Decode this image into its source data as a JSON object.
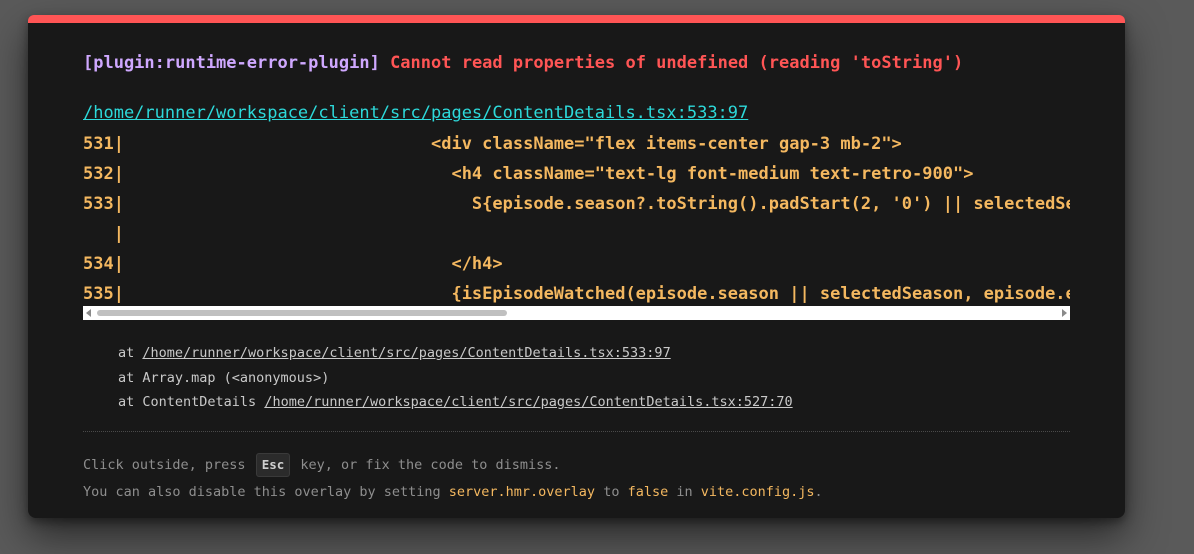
{
  "error": {
    "plugin": "[plugin:runtime-error-plugin]",
    "message": "Cannot read properties of undefined (reading 'toString')"
  },
  "file_link": "/home/runner/workspace/client/src/pages/ContentDetails.tsx:533:97",
  "code_lines": [
    "531|                              <div className=\"flex items-center gap-3 mb-2\">",
    "532|                                <h4 className=\"text-lg font-medium text-retro-900\">",
    "533|                                  S{episode.season?.toString().padStart(2, '0') || selectedSeason.toString().padStart(2, '0')}E{episode.episode",
    "   |",
    "534|                                </h4>",
    "535|                                {isEpisodeWatched(episode.season || selectedSeason, episode.episode) && ("
  ],
  "stack": [
    {
      "prefix": "at ",
      "loc": "/home/runner/workspace/client/src/pages/ContentDetails.tsx:533:97"
    },
    {
      "prefix": "at Array.map (<anonymous>)",
      "loc": ""
    },
    {
      "prefix": "at ContentDetails ",
      "loc": "/home/runner/workspace/client/src/pages/ContentDetails.tsx:527:70"
    }
  ],
  "tip1": {
    "before": "Click outside, press ",
    "key": "Esc",
    "after": " key, or fix the code to dismiss."
  },
  "tip2": {
    "part1": "You can also disable this overlay by setting ",
    "code1": "server.hmr.overlay",
    "part2": " to ",
    "code2": "false",
    "part3": " in ",
    "code3": "vite.config.js",
    "part4": "."
  },
  "colors": {
    "accent_top": "#ff5555",
    "plugin": "#cfa8ff",
    "error": "#ff5555",
    "link": "#2dd9da",
    "code": "#f4b860"
  }
}
